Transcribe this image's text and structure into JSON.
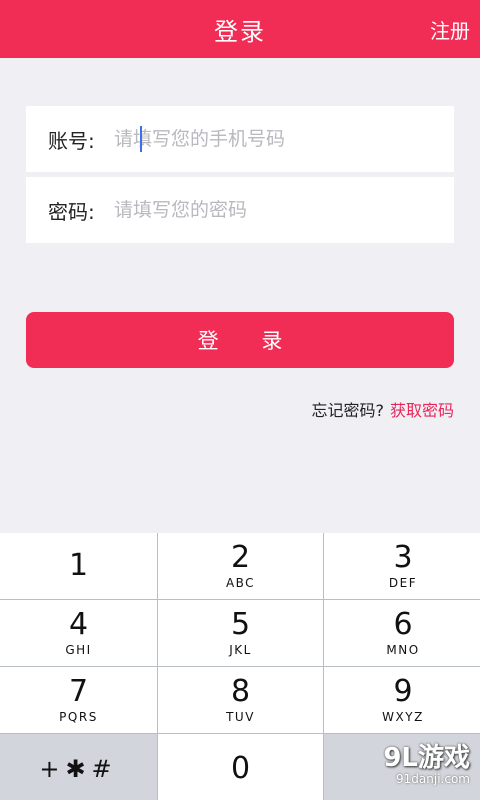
{
  "header": {
    "title": "登录",
    "right_action": "注册"
  },
  "form": {
    "account": {
      "label": "账号:",
      "placeholder": "请填写您的手机号码",
      "value": ""
    },
    "password": {
      "label": "密码:",
      "placeholder": "请填写您的密码",
      "value": ""
    }
  },
  "login_button": "登 录",
  "forgot": {
    "text": "忘记密码?",
    "link": "获取密码"
  },
  "keypad": {
    "keys": [
      {
        "num": "1",
        "letters": ""
      },
      {
        "num": "2",
        "letters": "ABC"
      },
      {
        "num": "3",
        "letters": "DEF"
      },
      {
        "num": "4",
        "letters": "GHI"
      },
      {
        "num": "5",
        "letters": "JKL"
      },
      {
        "num": "6",
        "letters": "MNO"
      },
      {
        "num": "7",
        "letters": "PQRS"
      },
      {
        "num": "8",
        "letters": "TUV"
      },
      {
        "num": "9",
        "letters": "WXYZ"
      },
      {
        "num": "+✱#",
        "letters": ""
      },
      {
        "num": "0",
        "letters": ""
      },
      {
        "num": "",
        "letters": ""
      }
    ]
  },
  "watermark": {
    "main": "9L游戏",
    "sub": "91danji.com"
  },
  "colors": {
    "accent": "#f22d55",
    "link": "#e8265a",
    "background": "#efeff4"
  }
}
